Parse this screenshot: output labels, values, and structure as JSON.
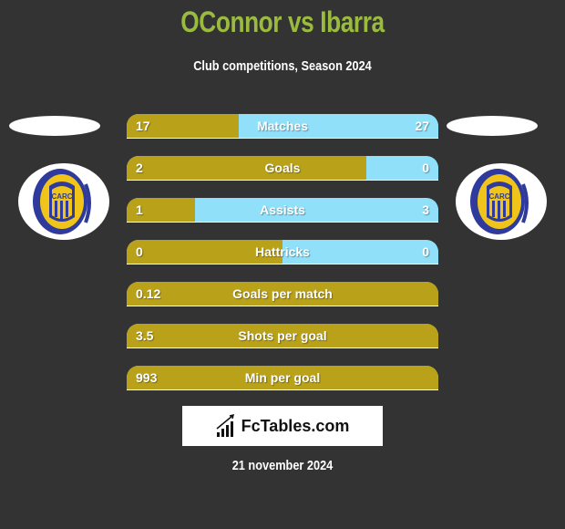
{
  "header": {
    "title": "OConnor vs Ibarra",
    "subtitle": "Club competitions, Season 2024"
  },
  "players": {
    "left": {
      "name": "OConnor",
      "logo_icon": "club-crest-icon"
    },
    "right": {
      "name": "Ibarra",
      "logo_icon": "club-crest-icon"
    }
  },
  "colors": {
    "left_bar": "#b9a21a",
    "right_bar": "#8fe0f8",
    "title": "#9bbb3e",
    "background": "#333333"
  },
  "chart_data": {
    "type": "bar",
    "title": "OConnor vs Ibarra",
    "subtitle": "Club competitions, Season 2024",
    "series": [
      {
        "name": "OConnor",
        "values": [
          "17",
          "2",
          "1",
          "0",
          "0.12",
          "3.5",
          "993"
        ]
      },
      {
        "name": "Ibarra",
        "values": [
          "27",
          "0",
          "3",
          "0",
          "",
          "",
          ""
        ]
      }
    ],
    "categories": [
      "Matches",
      "Goals",
      "Assists",
      "Hattricks",
      "Goals per match",
      "Shots per goal",
      "Min per goal"
    ],
    "rows": [
      {
        "label": "Matches",
        "left": "17",
        "right": "27",
        "left_share": 0.36
      },
      {
        "label": "Goals",
        "left": "2",
        "right": "0",
        "left_share": 0.77
      },
      {
        "label": "Assists",
        "left": "1",
        "right": "3",
        "left_share": 0.22
      },
      {
        "label": "Hattricks",
        "left": "0",
        "right": "0",
        "left_share": 0.5
      },
      {
        "label": "Goals per match",
        "left": "0.12",
        "right": "",
        "left_share": 1.0
      },
      {
        "label": "Shots per goal",
        "left": "3.5",
        "right": "",
        "left_share": 1.0
      },
      {
        "label": "Min per goal",
        "left": "993",
        "right": "",
        "left_share": 1.0
      }
    ]
  },
  "footer": {
    "brand": "FcTables.com",
    "brand_icon": "bar-chart-icon",
    "date": "21 november 2024"
  }
}
